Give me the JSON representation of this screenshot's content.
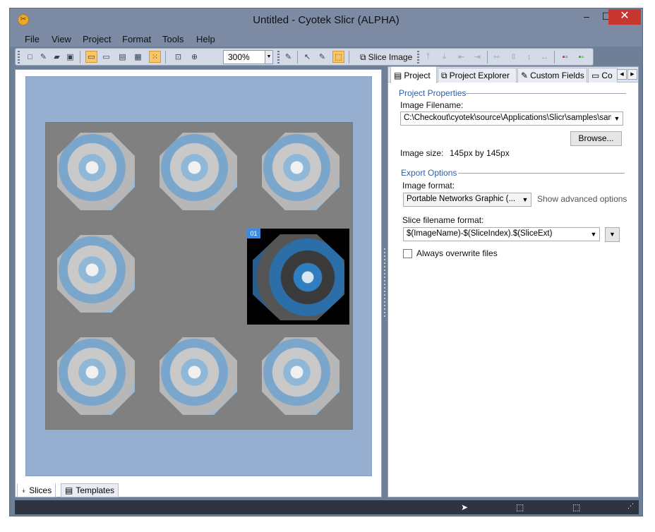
{
  "window": {
    "title": "Untitled - Cyotek Slicr  (ALPHA)",
    "controls": {
      "minimize": "–",
      "maximize": "☐",
      "close": "✕"
    }
  },
  "menu": [
    "File",
    "View",
    "Project",
    "Format",
    "Tools",
    "Help"
  ],
  "toolbar": {
    "zoom": "300%",
    "slice_image": "Slice Image",
    "icons": [
      "new-icon",
      "edit-icon",
      "open-icon",
      "save-icon",
      "canvas-icon",
      "slice-icon",
      "bordered-icon",
      "fill-icon",
      "grid-icon",
      "zoom-fit-icon",
      "zoom-icon",
      "slicer-icon",
      "pointer-icon",
      "pencil-icon",
      "select-icon",
      "slice-image-icon",
      "align-top-icon",
      "align-bottom-icon",
      "align-left-icon",
      "align-right-icon",
      "same-width-icon",
      "same-height-icon",
      "spacing-v-icon",
      "spacing-h-icon",
      "colors-icon",
      "colors2-icon"
    ]
  },
  "canvas": {
    "selected_slice_label": "01",
    "accent": "#3d8be0",
    "background": "#96afd0"
  },
  "left_tabs": [
    "Slices",
    "Templates"
  ],
  "right_tabs": [
    "Project",
    "Project Explorer",
    "Custom Fields",
    "Co"
  ],
  "project": {
    "properties_head": "Project Properties",
    "image_filename_label": "Image Filename:",
    "image_filename_value": "C:\\Checkout\\cyotek\\source\\Applications\\Slicr\\samples\\sample",
    "browse_label": "Browse...",
    "image_size_label": "Image size:",
    "image_size_value": "145px by 145px",
    "export_head": "Export Options",
    "image_format_label": "Image format:",
    "image_format_value": "Portable Networks Graphic (...",
    "advanced_label": "Show advanced options",
    "slice_format_label": "Slice filename format:",
    "slice_format_value": "$(ImageName)-$(SliceIndex).$(SliceExt)",
    "overwrite_label": "Always overwrite files"
  }
}
